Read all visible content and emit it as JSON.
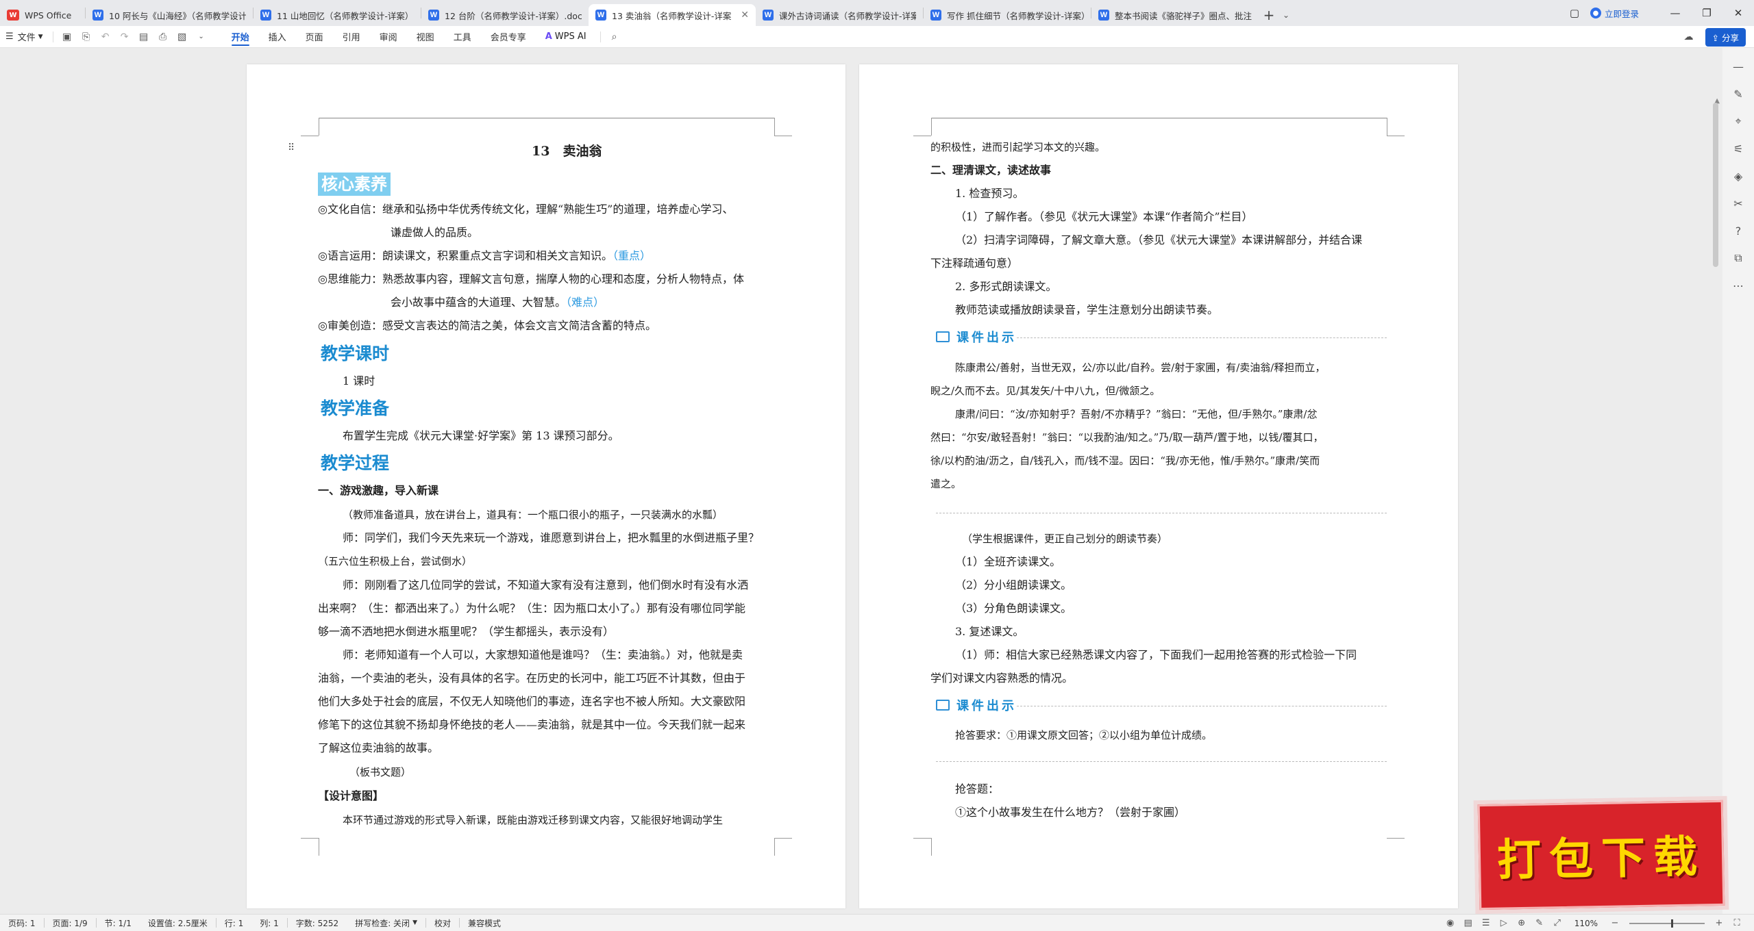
{
  "tabs": [
    {
      "label": "WPS Office",
      "icon": "wps-logo-icon",
      "active": false
    },
    {
      "label": "10 阿长与《山海经》（名师教学设计",
      "icon": "w-doc-icon",
      "active": false
    },
    {
      "label": "11 山地回忆（名师教学设计-详案）.d",
      "icon": "w-doc-icon",
      "active": false
    },
    {
      "label": "12 台阶（名师教学设计-详案）.doc",
      "icon": "w-doc-icon",
      "active": false
    },
    {
      "label": "13 卖油翁（名师教学设计-详案",
      "icon": "w-doc-icon",
      "active": true
    },
    {
      "label": "课外古诗词诵读（名师教学设计-详案",
      "icon": "w-doc-icon",
      "active": false
    },
    {
      "label": "写作 抓住细节（名师教学设计-详案）",
      "icon": "w-doc-icon",
      "active": false
    },
    {
      "label": "整本书阅读《骆驼祥子》圈点、批注",
      "icon": "w-doc-icon",
      "active": false
    }
  ],
  "window": {
    "login": "立即登录"
  },
  "menu": {
    "file": "文件",
    "tabs": [
      "开始",
      "插入",
      "页面",
      "引用",
      "审阅",
      "视图",
      "工具",
      "会员专享"
    ],
    "active": "开始",
    "ai": "WPS AI",
    "share": "分享"
  },
  "left_page": {
    "title": "13　卖油翁",
    "section_core": "核心素养",
    "core_items": [
      {
        "text": "◎文化自信：继承和弘扬中华优秀传统文化，理解“熟能生巧”的道理，培养虚心学习、",
        "cont": "谦虚做人的品质。"
      },
      {
        "text": "◎语言运用：朗读课文，积累重点文言字词和相关文言知识。",
        "tag": "（重点）"
      },
      {
        "text": "◎思维能力：熟悉故事内容，理解文言句意，揣摩人物的心理和态度，分析人物特点，体",
        "cont": "会小故事中蕴含的大道理、大智慧。",
        "tag": "（难点）"
      },
      {
        "text": "◎审美创造：感受文言表达的简洁之美，体会文言文简洁含蓄的特点。"
      }
    ],
    "section_time": "教学课时",
    "time_text": "1 课时",
    "section_prep": "教学准备",
    "prep_text": "布置学生完成《状元大课堂·好学案》第 13 课预习部分。",
    "section_process": "教学过程",
    "step1_title": "一、游戏激趣，导入新课",
    "p1": "（教师准备道具，放在讲台上，道具有：一个瓶口很小的瓶子，一只装满水的水瓢）",
    "p2a": "师：同学们，我们今天先来玩一个游戏，谁愿意到讲台上，把水瓢里的水倒进瓶子里？",
    "p2b": "（五六位生积极上台，尝试倒水）",
    "p3a": "师：刚刚看了这几位同学的尝试，不知道大家有没有注意到，他们倒水时有没有水洒",
    "p3b": "出来啊？（生：都洒出来了。）为什么呢？（生：因为瓶口太小了。）那有没有哪位同学能",
    "p3c": "够一滴不洒地把水倒进水瓶里呢？（学生都摇头，表示没有）",
    "p4a": "师：老师知道有一个人可以，大家想知道他是谁吗？（生：卖油翁。）对，他就是卖",
    "p4b": "油翁，一个卖油的老头，没有具体的名字。在历史的长河中，能工巧匠不计其数，但由于",
    "p4c": "他们大多处于社会的底层，不仅无人知晓他们的事迹，连名字也不被人所知。大文豪欧阳",
    "p4d": "修笔下的这位其貌不扬却身怀绝技的老人——卖油翁，就是其中一位。今天我们就一起来",
    "p4e": "了解这位卖油翁的故事。",
    "p5": "（板书文题）",
    "design_title": "【设计意图】",
    "design_text": "本环节通过游戏的形式导入新课，既能由游戏迁移到课文内容，又能很好地调动学生"
  },
  "right_page": {
    "r1": "的积极性，进而引起学习本文的兴趣。",
    "step2_title": "二、理清课文，读述故事",
    "r2": "1. 检查预习。",
    "r3": "（1）了解作者。（参见《状元大课堂》本课“作者简介”栏目）",
    "r4a": "（2）扫清字词障碍，了解文章大意。（参见《状元大课堂》本课讲解部分，并结合课",
    "r4b": "下注释疏通句意）",
    "r5": "2. 多形式朗读课文。",
    "r6": "教师范读或播放朗读录音，学生注意划分出朗读节奏。",
    "kj_label": "课件出示",
    "k1a": "陈康肃公/善射，当世无双，公/亦以此/自矜。尝/射于家圃，有/卖油翁/释担而立，",
    "k1b": "睨之/久而不去。见/其发矢/十中八九，但/微颔之。",
    "k2a": "康肃/问曰：“汝/亦知射乎？吾射/不亦精乎？”翁曰：“无他，但/手熟尔。”康肃/忿",
    "k2b": "然曰：“尔安/敢轻吾射！”翁曰：“以我酌油/知之。”乃/取一葫芦/置于地，以钱/覆其口，",
    "k2c": "徐/以杓酌油/沥之，自/钱孔入，而/钱不湿。因曰：“我/亦无他，惟/手熟尔。”康肃/笑而",
    "k2d": "遣之。",
    "r7": "（学生根据课件，更正自己划分的朗读节奏）",
    "r8": "（1）全班齐读课文。",
    "r9": "（2）分小组朗读课文。",
    "r10": "（3）分角色朗读课文。",
    "r11": "3. 复述课文。",
    "r12a": "（1）师：相信大家已经熟悉课文内容了，下面我们一起用抢答赛的形式检验一下同",
    "r12b": "学们对课文内容熟悉的情况。",
    "kj_label2": "课件出示",
    "k3": "抢答要求：①用课文原文回答；②以小组为单位计成绩。",
    "r13": "抢答题：",
    "r14": "①这个小故事发生在什么地方？（尝射于家圃）"
  },
  "badge": {
    "text": "打包下载"
  },
  "status": {
    "page_code": "页码: 1",
    "page": "页面: 1/9",
    "section": "节: 1/1",
    "setting": "设置值: 2.5厘米",
    "row": "行: 1",
    "col": "列: 1",
    "words": "字数: 5252",
    "spell": "拼写检查: 关闭",
    "proof": "校对",
    "compat": "兼容模式",
    "zoom": "110%",
    "zoom_level": 0.55
  }
}
